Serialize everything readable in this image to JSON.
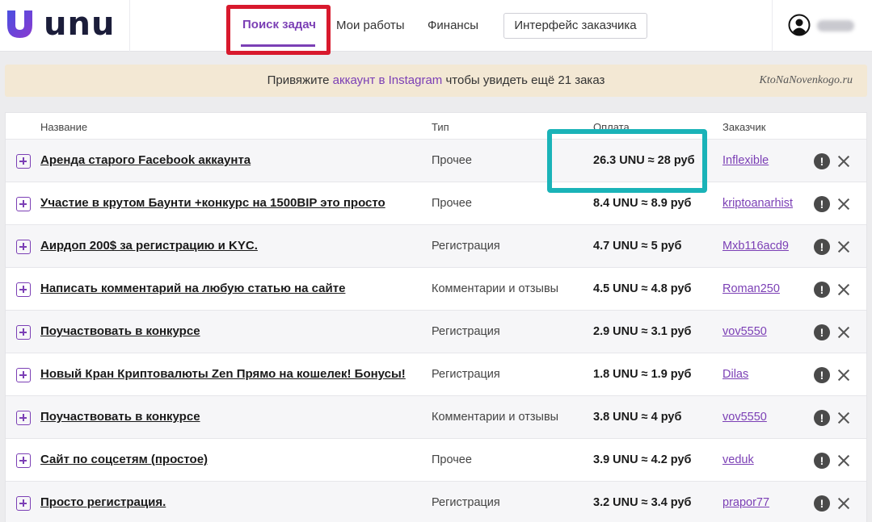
{
  "header": {
    "logo_text": "unu",
    "nav": {
      "active": "Поиск задач",
      "works": "Мои работы",
      "finance": "Финансы"
    },
    "client_button": "Интерфейс заказчика"
  },
  "banner": {
    "before": "Привяжите ",
    "link": "аккаунт в Instagram",
    "after": " чтобы увидеть ещё 21 заказ",
    "watermark": "KtoNaNovenkogo.ru"
  },
  "table": {
    "headers": {
      "name": "Название",
      "type": "Тип",
      "payment": "Оплата",
      "customer": "Заказчик"
    },
    "rows": [
      {
        "title": "Аренда старого Facebook аккаунта",
        "type": "Прочее",
        "payment": "26.3 UNU ≈ 28 руб",
        "customer": "Inflexible"
      },
      {
        "title": "Участие в крутом Баунти +конкурс на 1500BIP это просто",
        "type": "Прочее",
        "payment": "8.4 UNU ≈ 8.9 руб",
        "customer": "kriptoanarhist"
      },
      {
        "title": "Аирдоп 200$ за регистрацию и KYC.",
        "type": "Регистрация",
        "payment": "4.7 UNU ≈ 5 руб",
        "customer": "Mxb116acd9"
      },
      {
        "title": "Написать комментарий на любую статью на сайте",
        "type": "Комментарии и отзывы",
        "payment": "4.5 UNU ≈ 4.8 руб",
        "customer": "Roman250"
      },
      {
        "title": "Поучаствовать в конкурсе",
        "type": "Регистрация",
        "payment": "2.9 UNU ≈ 3.1 руб",
        "customer": "vov5550"
      },
      {
        "title": "Новый Кран Криптовалюты Zen Прямо на кошелек! Бонусы!",
        "type": "Регистрация",
        "payment": "1.8 UNU ≈ 1.9 руб",
        "customer": "Dilas"
      },
      {
        "title": "Поучаствовать в конкурсе",
        "type": "Комментарии и отзывы",
        "payment": "3.8 UNU ≈ 4 руб",
        "customer": "vov5550"
      },
      {
        "title": "Сайт по соцсетям (простое)",
        "type": "Прочее",
        "payment": "3.9 UNU ≈ 4.2 руб",
        "customer": "veduk"
      },
      {
        "title": "Просто регистрация.",
        "type": "Регистрация",
        "payment": "3.2 UNU ≈ 3.4 руб",
        "customer": "prapor77"
      }
    ],
    "warn_glyph": "!"
  },
  "colors": {
    "accent": "#7b3fb5",
    "annotation_red": "#d8192d",
    "annotation_teal": "#1ab3b8",
    "banner_bg": "#f3e8d4"
  },
  "icons": {
    "logo": "unu-logo-icon",
    "avatar": "user-avatar-icon",
    "expand": "plus-square-icon",
    "warning": "exclamation-circle-icon",
    "close": "close-icon"
  }
}
